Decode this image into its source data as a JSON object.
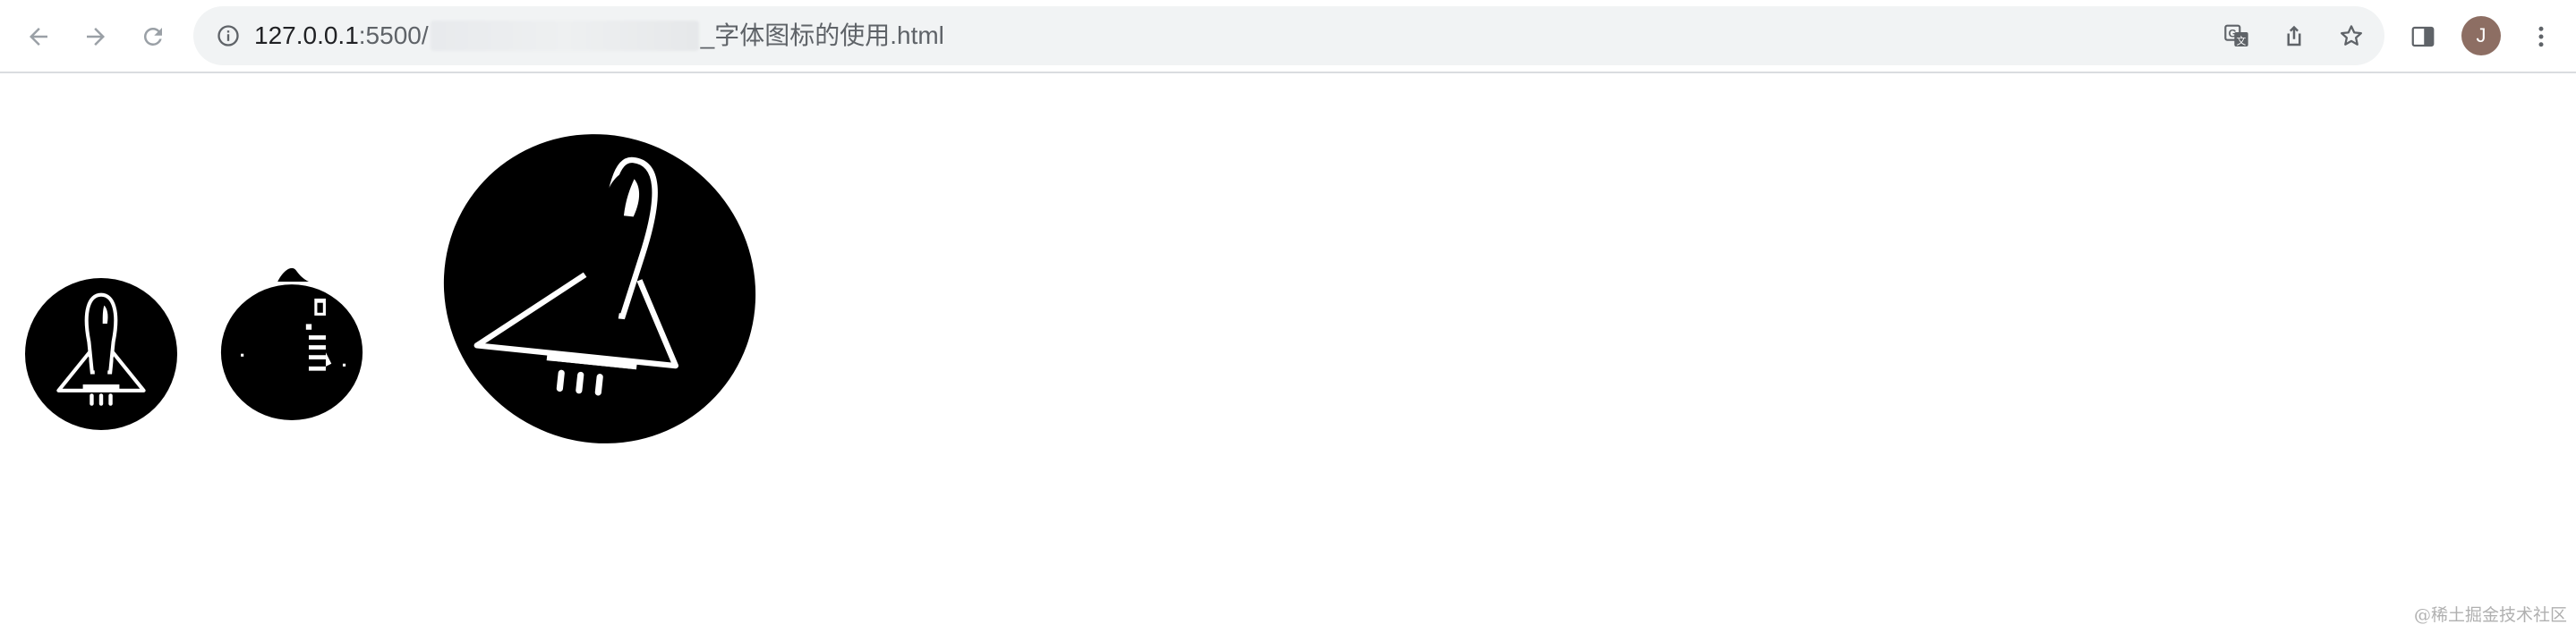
{
  "browser": {
    "url_host": "127.0.0.1",
    "url_port_path": ":5500/",
    "url_file": "_字体图标的使用.html",
    "profile_initial": "J"
  },
  "content": {
    "icons": [
      "rocket-icon",
      "rocket-icon",
      "rocket-icon"
    ]
  },
  "watermark": "@稀土掘金技术社区"
}
